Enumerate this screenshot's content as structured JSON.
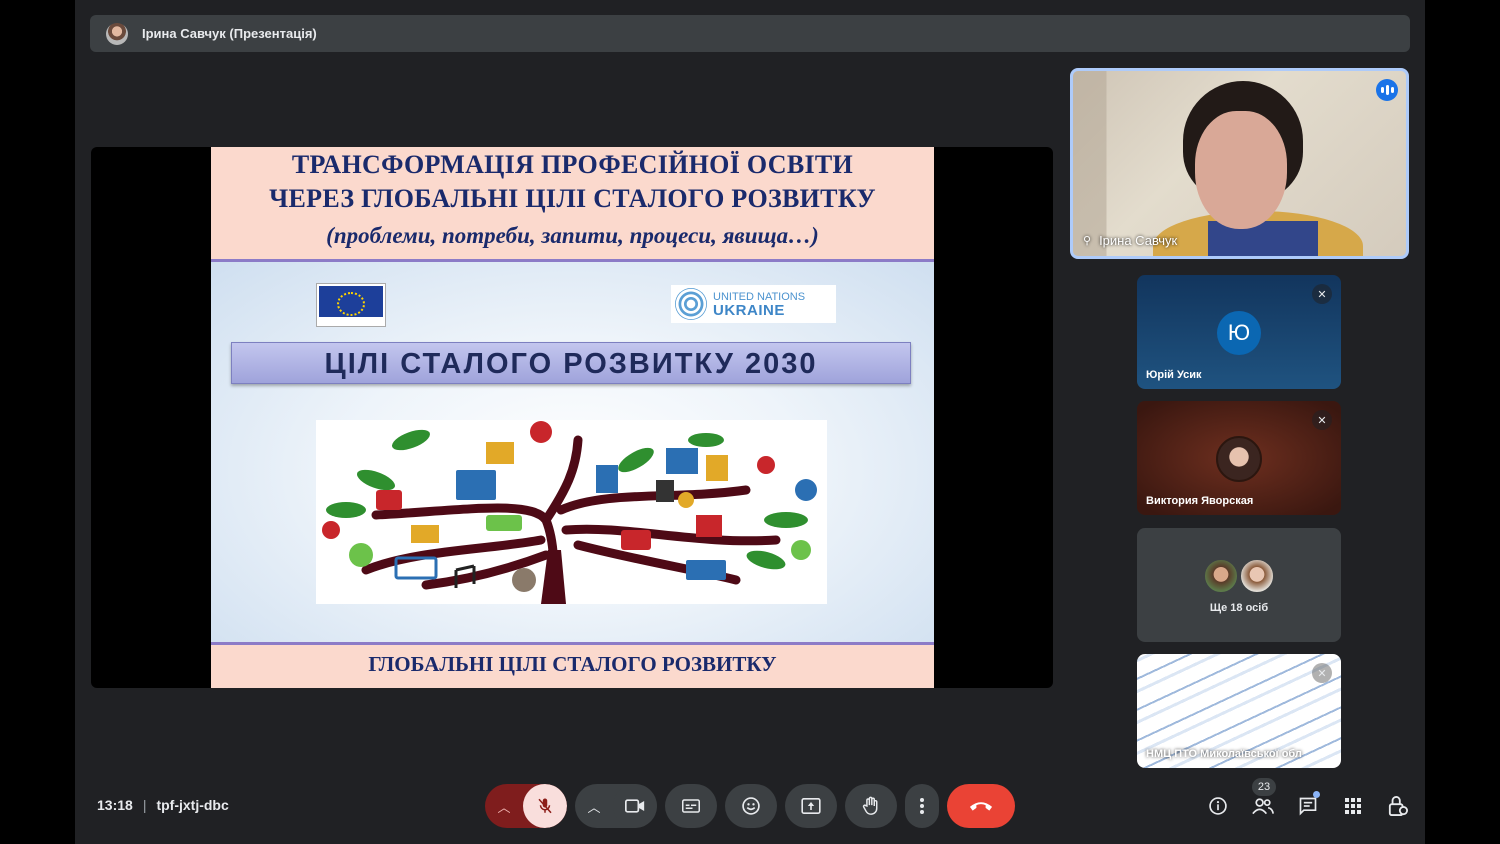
{
  "presenter_bar": {
    "title": "Ірина Савчук (Презентація)"
  },
  "slide": {
    "title_line1": "ТРАНСФОРМАЦІЯ ПРОФЕСІЙНОЇ ОСВІТИ",
    "title_line2": "ЧЕРЕЗ ГЛОБАЛЬНІ ЦІЛІ СТАЛОГО РОЗВИТКУ",
    "subtitle": "(проблеми, потреби, запити, процеси, явища…)",
    "un_line1": "UNITED NATIONS",
    "un_line2": "UKRAINE",
    "banner": "ЦІЛІ СТАЛОГО РОЗВИТКУ 2030",
    "footer": "ГЛОБАЛЬНІ ЦІЛІ СТАЛОГО РОЗВИТКУ"
  },
  "participants": {
    "self_name": "Ірина Савчук",
    "tiles": [
      {
        "name": "Юрій Усик",
        "initial": "Ю",
        "muted": true
      },
      {
        "name": "Виктория Яворская",
        "muted": true
      },
      {
        "name": "Ще 18 осіб"
      },
      {
        "name": "НМЦ ПТО Миколаївської обл",
        "muted": true
      }
    ]
  },
  "bottombar": {
    "time": "13:18",
    "separator": "|",
    "meeting_code": "tpf-jxtj-dbc",
    "people_count": "23"
  },
  "colors": {
    "background": "#202124",
    "tile_bg": "#3c4043",
    "hangup": "#ea4335",
    "mic_off_bg": "#f9dedc",
    "active_speaker_border": "#aecbfa"
  },
  "icons": {
    "mic_off": "mic-off-icon",
    "camera": "videocam-icon",
    "captions": "closed-caption-icon",
    "emoji": "emoji-icon",
    "present": "present-screen-icon",
    "hand": "raise-hand-icon",
    "more": "more-vert-icon",
    "hangup": "call-end-icon",
    "info": "info-icon",
    "people": "people-icon",
    "chat": "chat-icon",
    "activities": "apps-icon",
    "host_controls": "lock-person-icon"
  }
}
